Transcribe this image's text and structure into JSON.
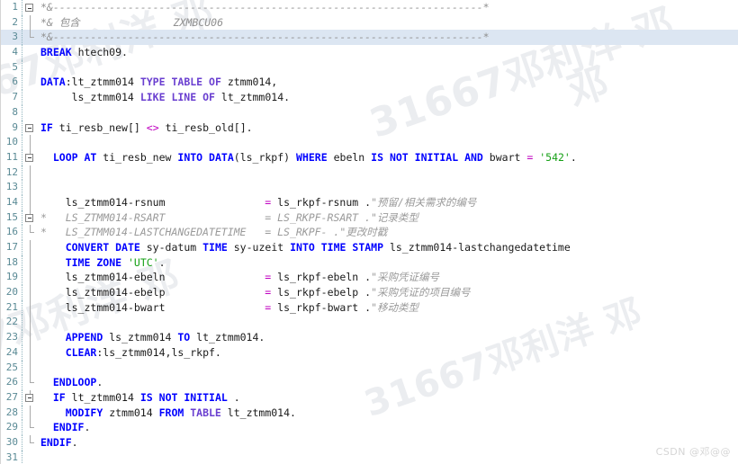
{
  "editor": {
    "language": "ABAP",
    "current_line": 3,
    "total_visible_lines": 31,
    "colors": {
      "keyword": "#0000ff",
      "keyword_alt": "#6a3fd0",
      "string": "#15a015",
      "operator": "#c000c0",
      "comment": "#9a9a9a",
      "gutter": "#5a8a95",
      "current_line_bg": "#dce6f2",
      "background": "#ffffff"
    }
  },
  "watermarks": {
    "diagonal": [
      "67邓利洋 邓",
      "31667邓利洋 邓",
      "7邓利洋 邓",
      "31667邓利洋 邓",
      "邓"
    ],
    "footer": "CSDN @邓@@"
  },
  "lines": [
    {
      "n": "1",
      "fold": "box-open",
      "text": "*&---------------------------------------------------------------------*"
    },
    {
      "n": "2",
      "fold": "vline",
      "text": "*& 包含               ZXMBCU06"
    },
    {
      "n": "3",
      "fold": "corner",
      "text": "*&---------------------------------------------------------------------*"
    },
    {
      "n": "4",
      "fold": "none",
      "text": "BREAK htech09."
    },
    {
      "n": "5",
      "fold": "none",
      "text": ""
    },
    {
      "n": "6",
      "fold": "none",
      "text": "DATA:lt_ztmm014 TYPE TABLE OF ztmm014,"
    },
    {
      "n": "7",
      "fold": "none",
      "text": "     ls_ztmm014 LIKE LINE OF lt_ztmm014."
    },
    {
      "n": "8",
      "fold": "none",
      "text": ""
    },
    {
      "n": "9",
      "fold": "box-open",
      "text": "IF ti_resb_new[] <> ti_resb_old[]."
    },
    {
      "n": "10",
      "fold": "vline",
      "text": ""
    },
    {
      "n": "11",
      "fold": "box-nested",
      "text": "  LOOP AT ti_resb_new INTO DATA(ls_rkpf) WHERE ebeln IS NOT INITIAL AND bwart = '542'."
    },
    {
      "n": "12",
      "fold": "vline",
      "text": ""
    },
    {
      "n": "13",
      "fold": "vline",
      "text": ""
    },
    {
      "n": "14",
      "fold": "vline",
      "text": "    ls_ztmm014-rsnum                = ls_rkpf-rsnum .\"预留/相关需求的编号"
    },
    {
      "n": "15",
      "fold": "box-nested",
      "text": "*   LS_ZTMM014-RSART                = LS_RKPF-RSART .\"记录类型"
    },
    {
      "n": "16",
      "fold": "tick",
      "text": "*   LS_ZTMM014-LASTCHANGEDATETIME   = LS_RKPF- .\"更改时戳"
    },
    {
      "n": "17",
      "fold": "vline",
      "text": "    CONVERT DATE sy-datum TIME sy-uzeit INTO TIME STAMP ls_ztmm014-lastchangedatetime"
    },
    {
      "n": "18",
      "fold": "vline",
      "text": "    TIME ZONE 'UTC'."
    },
    {
      "n": "19",
      "fold": "vline",
      "text": "    ls_ztmm014-ebeln                = ls_rkpf-ebeln .\"采购凭证编号"
    },
    {
      "n": "20",
      "fold": "vline",
      "text": "    ls_ztmm014-ebelp                = ls_rkpf-ebelp .\"采购凭证的项目编号"
    },
    {
      "n": "21",
      "fold": "vline",
      "text": "    ls_ztmm014-bwart                = ls_rkpf-bwart .\"移动类型"
    },
    {
      "n": "22",
      "fold": "vline",
      "text": ""
    },
    {
      "n": "23",
      "fold": "vline",
      "text": "    APPEND ls_ztmm014 TO lt_ztmm014."
    },
    {
      "n": "24",
      "fold": "vline",
      "text": "    CLEAR:ls_ztmm014,ls_rkpf."
    },
    {
      "n": "25",
      "fold": "vline",
      "text": ""
    },
    {
      "n": "26",
      "fold": "tick",
      "text": "  ENDLOOP."
    },
    {
      "n": "27",
      "fold": "box-nested",
      "text": "  IF lt_ztmm014 IS NOT INITIAL ."
    },
    {
      "n": "28",
      "fold": "vline",
      "text": "    MODIFY ztmm014 FROM TABLE lt_ztmm014."
    },
    {
      "n": "29",
      "fold": "tick",
      "text": "  ENDIF."
    },
    {
      "n": "30",
      "fold": "corner",
      "text": "ENDIF."
    },
    {
      "n": "31",
      "fold": "none",
      "text": ""
    }
  ],
  "tokens": {
    "keywords": [
      "BREAK",
      "DATA",
      "IF",
      "LOOP",
      "AT",
      "INTO",
      "WHERE",
      "IS",
      "NOT",
      "INITIAL",
      "AND",
      "CONVERT",
      "DATE",
      "TIME",
      "STAMP",
      "ZONE",
      "APPEND",
      "TO",
      "CLEAR",
      "ENDLOOP",
      "ENDIF",
      "MODIFY",
      "FROM",
      "TABLE",
      "TYPE",
      "OF",
      "LIKE",
      "LINE"
    ],
    "strings": [
      "'542'",
      "'UTC'"
    ],
    "comments": [
      "*&---------------------------------------------------------------------*",
      "*& 包含               ZXMBCU06",
      "\"预留/相关需求的编号",
      "\"记录类型",
      "\"更改时戳",
      "\"采购凭证编号",
      "\"采购凭证的项目编号",
      "\"移动类型"
    ],
    "include_name": "ZXMBCU06",
    "include_label": "包含"
  }
}
